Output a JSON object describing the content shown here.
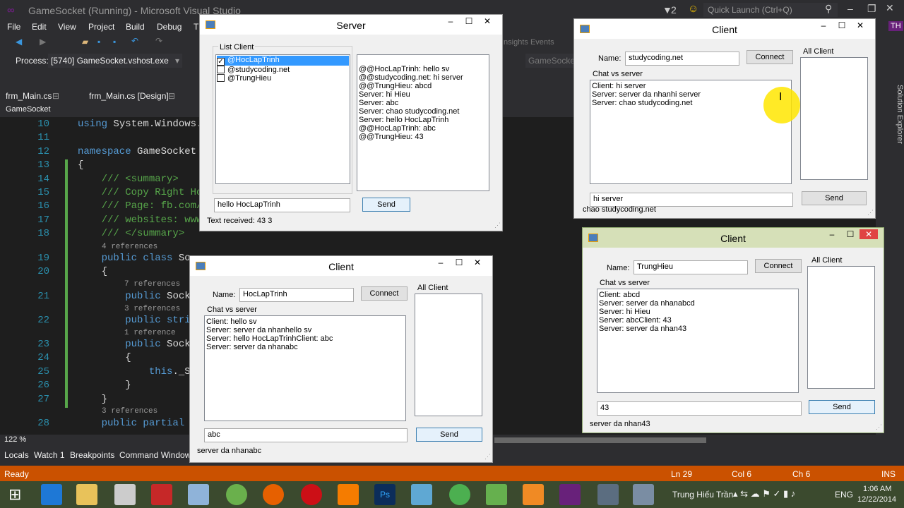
{
  "vs": {
    "title": "GameSocket (Running) - Microsoft Visual Studio",
    "notif_count": "2",
    "quick_launch": "Quick Launch (Ctrl+Q)",
    "user_initials": "TH",
    "menu": [
      "File",
      "Edit",
      "View",
      "Project",
      "Build",
      "Debug",
      "T"
    ],
    "insights": "Insights Events",
    "process_label": "Process:",
    "process_value": "[5740] GameSocket.vshost.exe",
    "name_field": "GameSocket",
    "tabs": [
      "frm_Main.cs",
      "frm_Main.cs [Design]"
    ],
    "nav": "GameSocket",
    "zoom": "122 %",
    "solution_explorer": "Solution Explorer",
    "bottom_tabs": [
      "Locals",
      "Watch 1",
      "Breakpoints",
      "Command Window"
    ],
    "status": {
      "ready": "Ready",
      "ln": "Ln 29",
      "col": "Col 6",
      "ch": "Ch 6",
      "ins": "INS"
    }
  },
  "code": {
    "lines": [
      {
        "n": "10",
        "t": "using System.Windows."
      },
      {
        "n": "11",
        "t": ""
      },
      {
        "n": "12",
        "t": "namespace GameSocket"
      },
      {
        "n": "13",
        "t": "{"
      },
      {
        "n": "14",
        "t": "    /// <summary>"
      },
      {
        "n": "15",
        "t": "    /// Copy Right Ho"
      },
      {
        "n": "16",
        "t": "    /// Page: fb.com/"
      },
      {
        "n": "17",
        "t": "    /// websites: www"
      },
      {
        "n": "18",
        "t": "    /// </summary>"
      },
      {
        "n": "19",
        "t": "    public class So"
      },
      {
        "n": "20",
        "t": "    {"
      },
      {
        "n": "21",
        "t": "        public Sock"
      },
      {
        "n": "22",
        "t": "        public stri"
      },
      {
        "n": "23",
        "t": "        public Sock"
      },
      {
        "n": "24",
        "t": "        {"
      },
      {
        "n": "25",
        "t": "            this._S"
      },
      {
        "n": "26",
        "t": "        }"
      },
      {
        "n": "27",
        "t": "    }"
      },
      {
        "n": "28",
        "t": "    public partial"
      }
    ],
    "refs": [
      "4 references",
      "7 references",
      "3 references",
      "1 reference",
      "3 references"
    ]
  },
  "server": {
    "title": "Server",
    "group_label": "List Client",
    "clients": [
      {
        "name": "@HocLapTrinh",
        "checked": true
      },
      {
        "name": "@studycoding.net",
        "checked": false
      },
      {
        "name": "@TrungHieu",
        "checked": false
      }
    ],
    "log": [
      "@@HocLapTrinh: hello sv",
      "@@studycoding.net: hi server",
      "@@TrungHieu: abcd",
      "Server: hi Hieu",
      "Server: abc",
      "Server: chao studycoding.net",
      "Server: hello HocLapTrinh",
      "@@HocLapTrinh: abc",
      "@@TrungHieu: 43"
    ],
    "input": "hello HocLapTrinh",
    "send": "Send",
    "status": "Text received: 43  3"
  },
  "client1": {
    "title": "Client",
    "name_label": "Name:",
    "name_value": "studycoding.net",
    "connect": "Connect",
    "all_client": "All Client",
    "chat_label": "Chat vs server",
    "chat": [
      "Client: hi server",
      "Server: server da nhanhi server",
      "Server: chao studycoding.net"
    ],
    "input": "hi server",
    "send": "Send",
    "status": "chao studycoding.net"
  },
  "client2": {
    "title": "Client",
    "name_label": "Name:",
    "name_value": "HocLapTrinh",
    "connect": "Connect",
    "all_client": "All Client",
    "chat_label": "Chat vs server",
    "chat": [
      "Client: hello sv",
      "Server: server da nhanhello sv",
      "Server: hello HocLapTrinhClient: abc",
      "Server: server da nhanabc"
    ],
    "input": "abc",
    "send": "Send",
    "status": "server da nhanabc"
  },
  "client3": {
    "title": "Client",
    "name_label": "Name:",
    "name_value": "TrungHieu",
    "connect": "Connect",
    "all_client": "All Client",
    "chat_label": "Chat vs server",
    "chat": [
      "Client: abcd",
      "Server: server da nhanabcd",
      "Server: hi Hieu",
      "Server: abcClient: 43",
      "Server: server da nhan43"
    ],
    "input": "43",
    "send": "Send",
    "status": "server da nhan43"
  },
  "taskbar": {
    "user": "Trung Hiếu Trần",
    "lang": "ENG",
    "time": "1:06 AM",
    "date": "12/22/2014"
  },
  "colors": {
    "vs_bg": "#2d2d30",
    "editor": "#1e1e1e",
    "status": "#ca5100",
    "accent": "#68217a"
  }
}
